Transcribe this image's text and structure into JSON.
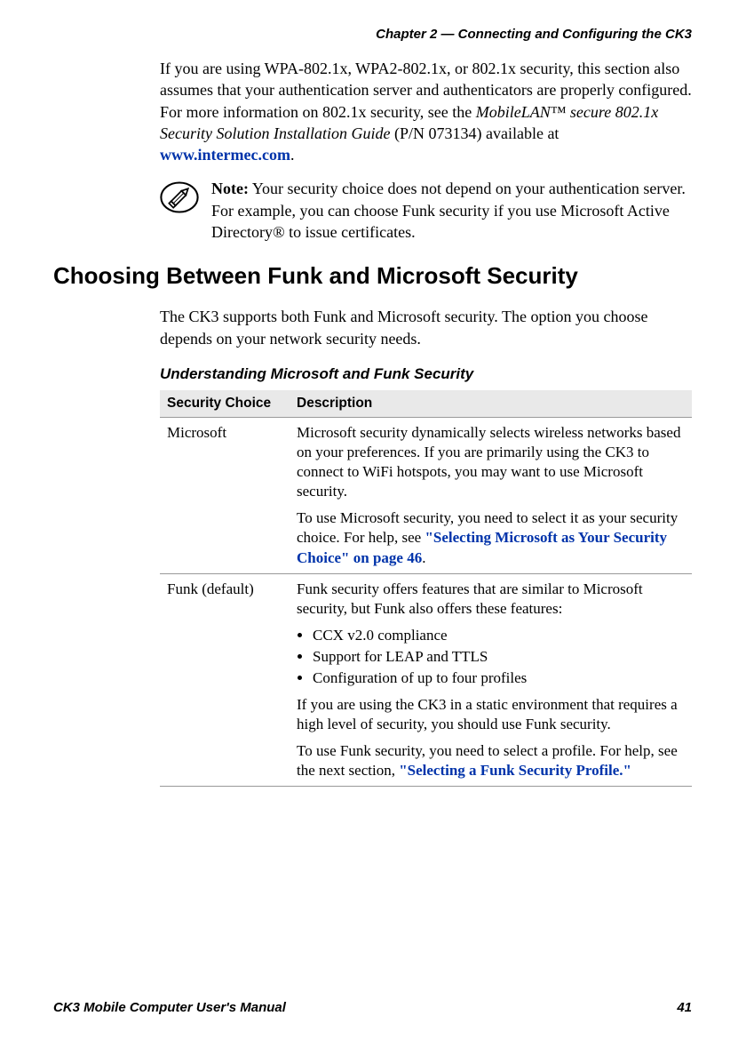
{
  "runningHead": "Chapter 2 — Connecting and Configuring the CK3",
  "intro": {
    "part1": "If you are using WPA-802.1x, WPA2-802.1x, or 802.1x security, this section also assumes that your authentication server and authenticators are properly configured. For more information on 802.1x security, see the ",
    "italic1": "MobileLAN™ secure 802.1x Security Solution Installation Guide",
    "part2": " (P/N 073134) available at ",
    "link": "www.intermec.com",
    "part3": "."
  },
  "note": {
    "label": "Note:",
    "text": " Your security choice does not depend on your authentication server. For example, you can choose Funk security if you use Microsoft Active Directory® to issue certificates."
  },
  "sectionHead": "Choosing Between Funk and Microsoft Security",
  "sectionIntro": "The CK3 supports both Funk and Microsoft security. The option you choose depends on your network security needs.",
  "table": {
    "title": "Understanding Microsoft and Funk Security",
    "headers": {
      "c1": "Security Choice",
      "c2": "Description"
    },
    "rows": [
      {
        "choice": "Microsoft",
        "p1": "Microsoft security dynamically selects wireless networks based on your preferences. If you are primarily using the CK3 to connect to WiFi hotspots, you may want to use Microsoft security.",
        "p2a": "To use Microsoft security, you need to select it as your security choice. For help, see ",
        "p2link": "\"Selecting Microsoft as Your Security Choice\" on page 46",
        "p2b": "."
      },
      {
        "choice": "Funk (default)",
        "p1": "Funk security offers features that are similar to Microsoft security, but Funk also offers these features:",
        "bullets": [
          "CCX v2.0 compliance",
          "Support for LEAP and TTLS",
          "Configuration of up to four profiles"
        ],
        "p2": "If you are using the CK3 in a static environment that requires a high level of security, you should use Funk security.",
        "p3a": "To use Funk security, you need to select a profile. For help, see the next section, ",
        "p3link": "\"Selecting a Funk Security Profile.\""
      }
    ]
  },
  "footer": {
    "left": "CK3 Mobile Computer User's Manual",
    "right": "41"
  }
}
